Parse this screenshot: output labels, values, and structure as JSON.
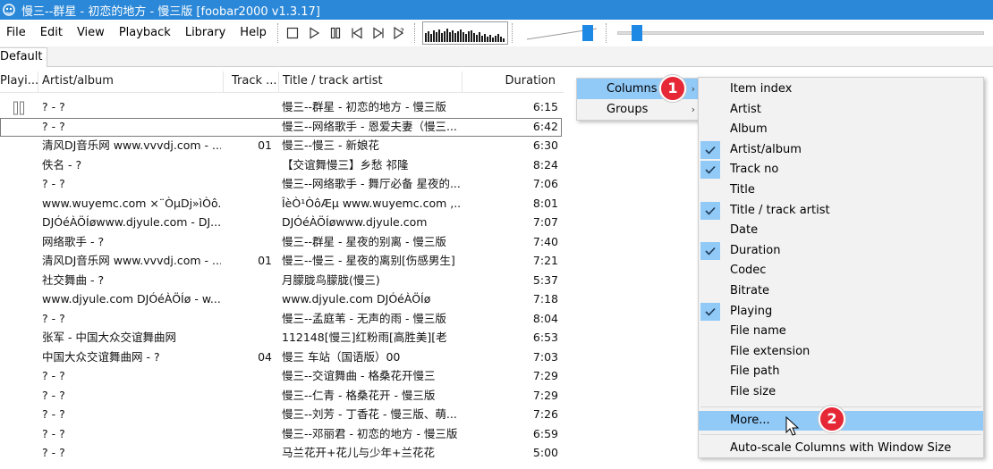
{
  "window": {
    "title": "慢三--群星 - 初恋的地方 - 慢三版  [foobar2000 v1.3.17]"
  },
  "menu": [
    "File",
    "Edit",
    "View",
    "Playback",
    "Library",
    "Help"
  ],
  "toolbar": {
    "buttons": [
      "stop-icon",
      "play-icon",
      "pause-icon",
      "previous-icon",
      "next-icon",
      "random-icon"
    ],
    "volume_level": 0.95,
    "seek_position": 0.04
  },
  "tabs": [
    "Default"
  ],
  "playlist": {
    "columns": [
      "Playi...",
      "Artist/album",
      "Track ...",
      "Title / track artist",
      "Duration"
    ],
    "rows": [
      {
        "playing": true,
        "artist": "? - ?",
        "track": "",
        "title": "慢三--群星 - 初恋的地方 - 慢三版",
        "duration": "6:15"
      },
      {
        "playing": false,
        "artist": "? - ?",
        "track": "",
        "title": "慢三--网络歌手 - 恩爱夫妻（慢三...",
        "duration": "6:42"
      },
      {
        "playing": false,
        "artist": "清风DJ音乐网 www.vvvdj.com - ...",
        "track": "01",
        "title": "慢三--慢三 - 新娘花",
        "duration": "6:30"
      },
      {
        "playing": false,
        "artist": "佚名 - ?",
        "track": "",
        "title": "【交谊舞慢三】乡愁 祁隆",
        "duration": "8:24"
      },
      {
        "playing": false,
        "artist": "? - ?",
        "track": "",
        "title": "慢三--网络歌手 - 舞厅必备 星夜的...",
        "duration": "7:06"
      },
      {
        "playing": false,
        "artist": "www.wuyemc.com ×¨ÒµDj»ìÒô...",
        "track": "",
        "title": "ÎèÒ¹ÒôÆµ www.wuyemc.com ,...",
        "duration": "8:01"
      },
      {
        "playing": false,
        "artist": "DJÓéÀÖÍøwww.djyule.com - DJ...",
        "track": "",
        "title": "DJÓéÀÖÍøwww.djyule.com",
        "duration": "7:07"
      },
      {
        "playing": false,
        "artist": "网络歌手 - ?",
        "track": "",
        "title": "慢三--群星 - 星夜的别离 - 慢三版",
        "duration": "7:40"
      },
      {
        "playing": false,
        "artist": "清风DJ音乐网 www.vvvdj.com - ...",
        "track": "01",
        "title": "慢三--慢三 - 星夜的离别[伤感男生]",
        "duration": "7:21"
      },
      {
        "playing": false,
        "artist": "社交舞曲 - ?",
        "track": "",
        "title": "月朦胧鸟朦胧(慢三)",
        "duration": "5:37"
      },
      {
        "playing": false,
        "artist": "www.djyule.com DJÓéÀÖÍø - w...",
        "track": "",
        "title": "www.djyule.com DJÓéÀÖÍø",
        "duration": "7:18"
      },
      {
        "playing": false,
        "artist": "? - ?",
        "track": "",
        "title": "慢三--孟庭苇 - 无声的雨 - 慢三版",
        "duration": "8:04"
      },
      {
        "playing": false,
        "artist": "张军 - 中国大众交谊舞曲网",
        "track": "",
        "title": "112148[慢三]红粉雨[高胜美][老",
        "duration": "6:53"
      },
      {
        "playing": false,
        "artist": "中国大众交谊舞曲网 - ?",
        "track": "04",
        "title": "慢三  车站（国语版）00",
        "duration": "7:03"
      },
      {
        "playing": false,
        "artist": "? - ?",
        "track": "",
        "title": "慢三--交谊舞曲 - 格桑花开慢三",
        "duration": "7:29"
      },
      {
        "playing": false,
        "artist": "? - ?",
        "track": "",
        "title": "慢三--仁青 - 格桑花开 - 慢三版",
        "duration": "7:29"
      },
      {
        "playing": false,
        "artist": "? - ?",
        "track": "",
        "title": "慢三--刘芳 - 丁香花 - 慢三版、萌...",
        "duration": "7:26"
      },
      {
        "playing": false,
        "artist": "? - ?",
        "track": "",
        "title": "慢三--邓丽君 - 初恋的地方 - 慢三版",
        "duration": "6:59"
      },
      {
        "playing": false,
        "artist": "? - ?",
        "track": "",
        "title": "马兰花开+花儿与少年+兰花花",
        "duration": "5:00"
      }
    ]
  },
  "context_menu": {
    "items": [
      {
        "label": "Columns",
        "highlighted": true
      },
      {
        "label": "Groups",
        "highlighted": false
      }
    ]
  },
  "columns_submenu": {
    "items": [
      {
        "label": "Item index",
        "checked": false
      },
      {
        "label": "Artist",
        "checked": false
      },
      {
        "label": "Album",
        "checked": false
      },
      {
        "label": "Artist/album",
        "checked": true
      },
      {
        "label": "Track no",
        "checked": true
      },
      {
        "label": "Title",
        "checked": false
      },
      {
        "label": "Title / track artist",
        "checked": true
      },
      {
        "label": "Date",
        "checked": false
      },
      {
        "label": "Duration",
        "checked": true
      },
      {
        "label": "Codec",
        "checked": false
      },
      {
        "label": "Bitrate",
        "checked": false
      },
      {
        "label": "Playing",
        "checked": true
      },
      {
        "label": "File name",
        "checked": false
      },
      {
        "label": "File extension",
        "checked": false
      },
      {
        "label": "File path",
        "checked": false
      },
      {
        "label": "File size",
        "checked": false
      }
    ],
    "more_label": "More...",
    "autoscale_label": "Auto-scale Columns with Window Size"
  },
  "badges": [
    "1",
    "2"
  ],
  "colors": {
    "titlebar": "#2b88d8",
    "highlight": "#91c9f7",
    "badge": "#e62836",
    "accent": "#1e88e5"
  }
}
